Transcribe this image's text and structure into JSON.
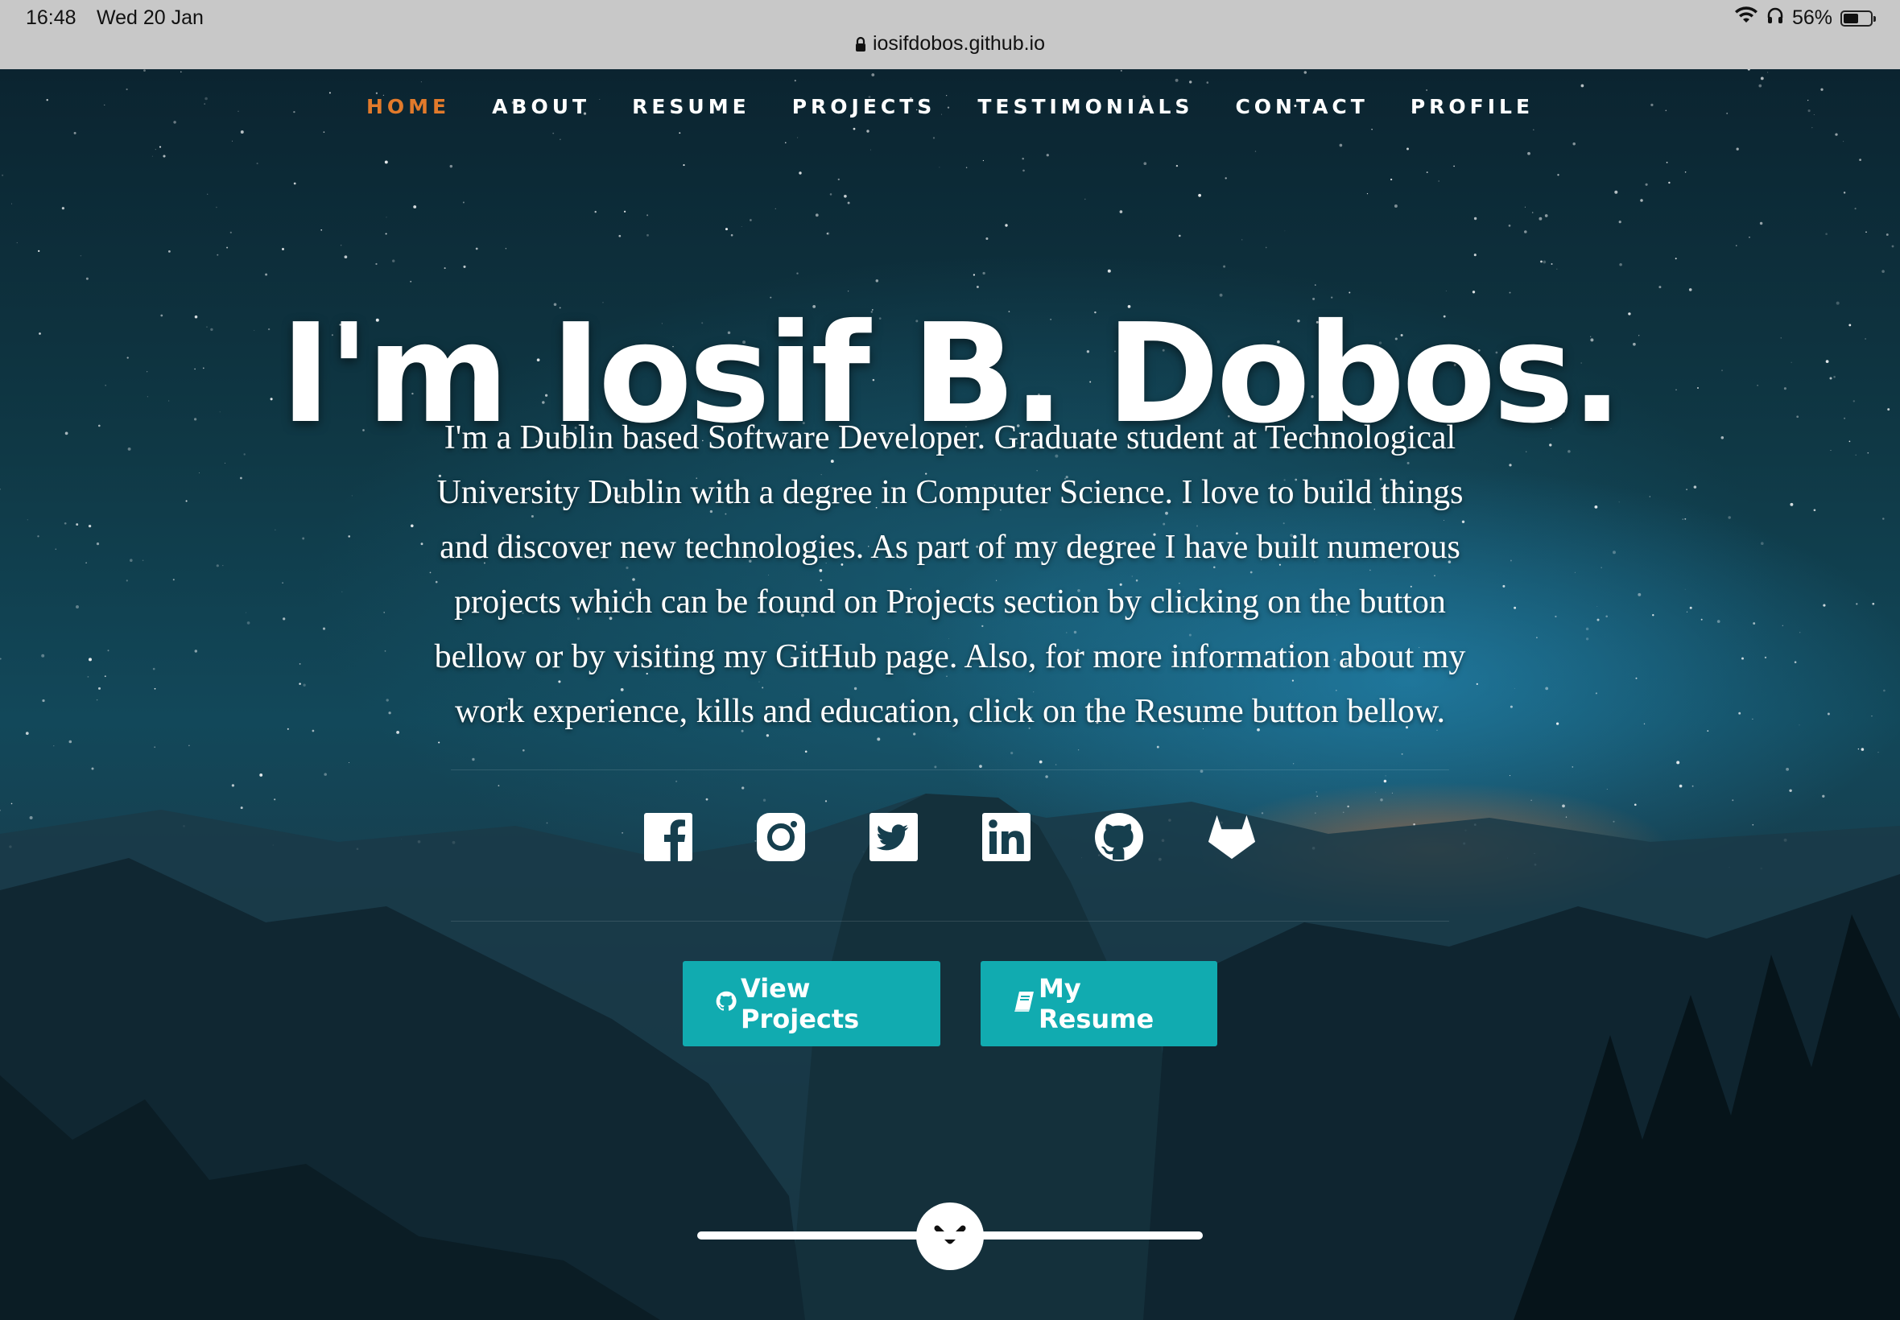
{
  "status_bar": {
    "time": "16:48",
    "date": "Wed 20 Jan",
    "battery": "56%",
    "battery_level": 0.56,
    "url": "iosifdobos.github.io"
  },
  "nav": {
    "items": [
      {
        "label": "HOME",
        "active": true
      },
      {
        "label": "ABOUT",
        "active": false
      },
      {
        "label": "RESUME",
        "active": false
      },
      {
        "label": "PROJECTS",
        "active": false
      },
      {
        "label": "TESTIMONIALS",
        "active": false
      },
      {
        "label": "CONTACT",
        "active": false
      },
      {
        "label": "PROFILE",
        "active": false
      }
    ],
    "active_color": "#e27a2b"
  },
  "hero": {
    "title": "I'm Iosif B. Dobos.",
    "intro_lines": [
      "I'm a Dublin based Software Developer. Graduate student at Technological",
      "University Dublin with a degree in Computer Science. I love to build things",
      "and discover new technologies. As part of my degree I have built numerous",
      "projects which can be found on Projects section by clicking on the button",
      "bellow or by visiting my GitHub page. Also, for more information about my",
      "work experience, kills and education, click on the Resume button bellow."
    ]
  },
  "social": [
    "facebook-icon",
    "instagram-icon",
    "twitter-icon",
    "linkedin-icon",
    "github-icon",
    "gitlab-icon"
  ],
  "buttons": {
    "projects_label": "View Projects",
    "resume_label": "My Resume",
    "color": "#11abb0"
  }
}
